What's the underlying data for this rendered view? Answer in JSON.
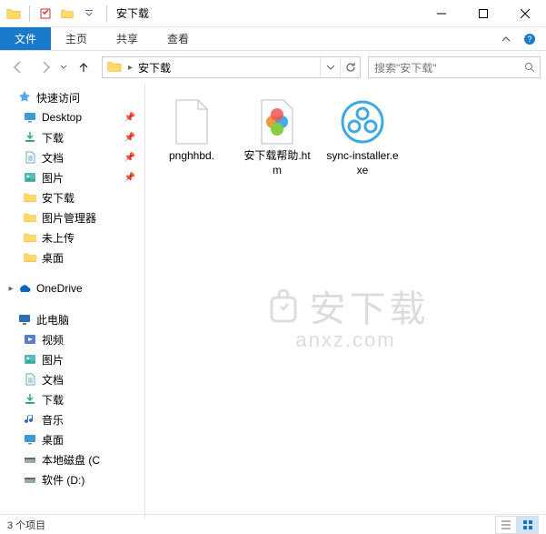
{
  "window": {
    "title": "安下载"
  },
  "ribbon": {
    "file": "文件",
    "tabs": [
      "主页",
      "共享",
      "查看"
    ]
  },
  "address": {
    "crumb": "安下载"
  },
  "search": {
    "placeholder": "搜索\"安下载\""
  },
  "sidebar": {
    "quick_access": "快速访问",
    "items_qa": [
      {
        "label": "Desktop",
        "pinned": true,
        "icon": "desktop"
      },
      {
        "label": "下载",
        "pinned": true,
        "icon": "downloads"
      },
      {
        "label": "文档",
        "pinned": true,
        "icon": "documents"
      },
      {
        "label": "图片",
        "pinned": true,
        "icon": "pictures"
      },
      {
        "label": "安下载",
        "pinned": false,
        "icon": "folder"
      },
      {
        "label": "图片管理器",
        "pinned": false,
        "icon": "folder"
      },
      {
        "label": "未上传",
        "pinned": false,
        "icon": "folder"
      },
      {
        "label": "桌面",
        "pinned": false,
        "icon": "folder"
      }
    ],
    "onedrive": "OneDrive",
    "thispc": "此电脑",
    "items_pc": [
      {
        "label": "视频",
        "icon": "videos"
      },
      {
        "label": "图片",
        "icon": "pictures"
      },
      {
        "label": "文档",
        "icon": "documents"
      },
      {
        "label": "下载",
        "icon": "downloads"
      },
      {
        "label": "音乐",
        "icon": "music"
      },
      {
        "label": "桌面",
        "icon": "desktop"
      },
      {
        "label": "本地磁盘 (C",
        "icon": "drive"
      },
      {
        "label": "软件 (D:)",
        "icon": "drive"
      }
    ]
  },
  "files": [
    {
      "name": "pnghhbd.",
      "type": "blank"
    },
    {
      "name": "安下载帮助.htm",
      "type": "htm"
    },
    {
      "name": "sync-installer.exe",
      "type": "sync"
    }
  ],
  "watermark": {
    "top": "安下载",
    "bottom": "anxz.com"
  },
  "status": {
    "text": "3 个项目"
  }
}
